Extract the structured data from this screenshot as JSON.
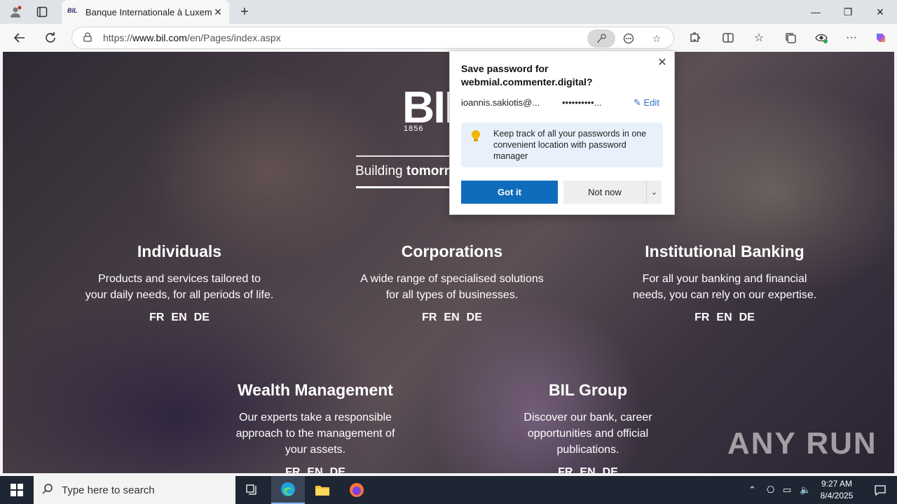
{
  "browser": {
    "tab_title": "Banque Internationale à Luxembo",
    "tab_favicon": "BIL",
    "url_prefix": "https://",
    "url_host": "www.bil.com",
    "url_path": "/en/Pages/index.aspx"
  },
  "page": {
    "logo": "BIL",
    "logo_year": "1856",
    "tagline_start": "Building ",
    "tagline_bold": "tomorr",
    "segments": [
      {
        "title": "Individuals",
        "line1": "Products and services tailored to",
        "line2": "your daily needs, for all periods of life.",
        "langs": [
          "FR",
          "EN",
          "DE"
        ]
      },
      {
        "title": "Corporations",
        "line1": "A wide range of specialised solutions",
        "line2": "for all types of businesses.",
        "langs": [
          "FR",
          "EN",
          "DE"
        ]
      },
      {
        "title": "Institutional Banking",
        "line1": "For all your banking and financial",
        "line2": "needs, you can rely on our expertise.",
        "langs": [
          "FR",
          "EN",
          "DE"
        ]
      },
      {
        "title": "Wealth Management",
        "line1": "Our experts take a responsible",
        "line2": "approach to the management of",
        "line3": "your assets.",
        "langs": [
          "FR",
          "EN",
          "DE"
        ]
      },
      {
        "title": "BIL Group",
        "line1": "Discover our bank, career",
        "line2": "opportunities and official",
        "line3": "publications.",
        "langs": [
          "FR",
          "EN",
          "DE"
        ]
      }
    ],
    "watermark": "ANY RUN"
  },
  "password_popup": {
    "title": "Save password for webmial.commenter.digital?",
    "username": "ioannis.sakiotis@...",
    "password": "••••••••••...",
    "edit_label": "Edit",
    "tip": "Keep track of all your passwords in one convenient location with password manager",
    "got_it": "Got it",
    "not_now": "Not now"
  },
  "taskbar": {
    "search_placeholder": "Type here to search",
    "time": "9:27 AM",
    "date": "8/4/2025"
  }
}
